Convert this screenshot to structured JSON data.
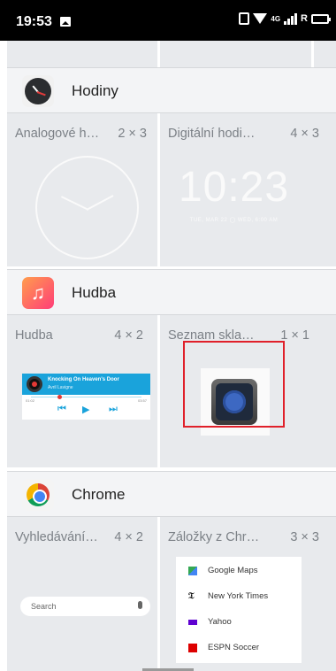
{
  "status_bar": {
    "time": "19:53",
    "icons": [
      "image-icon",
      "vibrate-icon",
      "wifi-icon",
      "signal-icon",
      "battery-icon"
    ],
    "network": "4G",
    "roaming": "R"
  },
  "sections": {
    "clock": {
      "app_name": "Hodiny",
      "widgets": [
        {
          "label": "Analogové h…",
          "size": "2 × 3"
        },
        {
          "label": "Digitální hodi…",
          "size": "4 × 3",
          "preview_time": "10:23",
          "preview_date": "TUE, MAR 22 ◯ WED, 6:00 AM"
        }
      ]
    },
    "music": {
      "app_name": "Hudba",
      "widgets": [
        {
          "label": "Hudba",
          "size": "4 × 2",
          "song_title": "Knocking On Heaven's Door",
          "artist": "Avril Lavigne",
          "time_start": "01:02",
          "time_end": "03:57"
        },
        {
          "label": "Seznam skla…",
          "size": "1 × 1"
        }
      ]
    },
    "chrome": {
      "app_name": "Chrome",
      "widgets": [
        {
          "label": "Vyhledávání…",
          "size": "4 × 2",
          "search_placeholder": "Search"
        },
        {
          "label": "Záložky z Chr…",
          "size": "3 × 3",
          "bookmarks": [
            "Google Maps",
            "New York Times",
            "Yahoo",
            "ESPN Soccer"
          ]
        }
      ]
    }
  },
  "colors": {
    "pane_bg": "#e8eaed",
    "header_bg": "#f3f4f6",
    "highlight_box": "#e0202a",
    "music_accent": "#1aa3db"
  }
}
